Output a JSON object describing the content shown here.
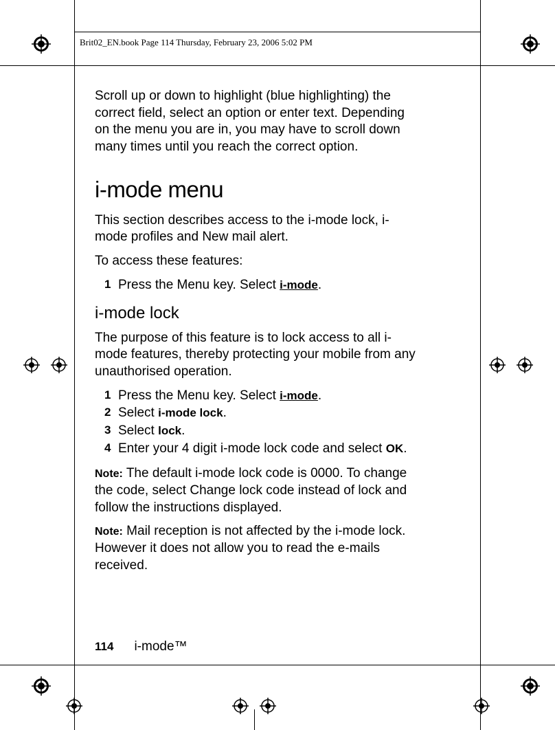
{
  "header": "Brit02_EN.book  Page 114  Thursday, February 23, 2006  5:02 PM",
  "intro": "Scroll up or down to highlight (blue highlighting) the correct field, select an option or enter text. Depending on the menu you are in, you may have to scroll down many times until you reach the correct option.",
  "heading1": "i-mode menu",
  "desc1": "This section describes access to the i-mode lock, i-mode pro­files and New mail alert.",
  "access": "To access these features:",
  "step1_pre": "Press the Menu key. Select ",
  "imode": "i-mode",
  "heading2": "i-mode lock",
  "desc2": "The purpose of this feature is to lock access to all i-mode features, thereby protecting your mobile from any unauthorised operation.",
  "lock_steps": {
    "s1_pre": "Press the Menu key. Select ",
    "s2_pre": "Select ",
    "s2_bold": "i-mode lock",
    "s3_pre": "Select ",
    "s3_bold": "lock",
    "s4_pre": "Enter your 4 digit i-mode lock code and select ",
    "s4_bold": "OK"
  },
  "note_label": "Note:",
  "note1": " The default i-mode lock code is 0000. To change the code, select Change lock code instead of lock and follow the instructions displayed.",
  "note2": " Mail reception is not affected by the i-mode lock. However it does not allow you to read the e-mails received.",
  "page_number": "114",
  "footer_text": "i-mode™"
}
